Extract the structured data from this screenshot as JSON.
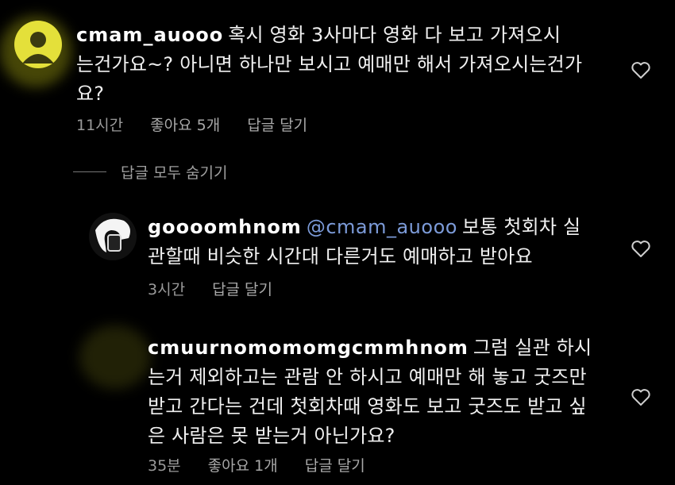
{
  "comments": [
    {
      "username": "cmam_auooo",
      "text_line1": "혹시 영화 3사마다 영화 다 보고 가져오시",
      "text_line2": "는건가요~? 아니면 하나만 보시고 예매만 해서 가져오시는건가",
      "text_line3": "요?",
      "time": "11시간",
      "likes": "좋아요 5개",
      "reply": "답글 달기"
    }
  ],
  "hide_replies": "답글 모두 숨기기",
  "replies": [
    {
      "username": "goooomhnom",
      "mention": "@cmam_auooo",
      "text_line1": "보통 첫회차 실",
      "text_line2": "관할때 비슷한 시간대 다른거도 예매하고 받아요",
      "time": "3시간",
      "reply": "답글 달기"
    },
    {
      "username": "cmuurnomomomgcmmhnom",
      "text_line1": "그럼 실관 하시",
      "text_line2": "는거 제외하고는 관람 안 하시고 예매만 해 놓고 굿즈만",
      "text_line3": "받고 간다는 건데 첫회차때 영화도 보고 굿즈도 받고 싶",
      "text_line4": "은 사람은 못 받는거 아닌가요?",
      "time": "35분",
      "likes": "좋아요 1개",
      "reply": "답글 달기"
    }
  ],
  "colors": {
    "background": "#000000",
    "mention": "#7c9bd9",
    "meta": "#9a9a9a",
    "avatar1": "#e8e23a"
  },
  "icons": {
    "like": "heart-outline-icon"
  }
}
